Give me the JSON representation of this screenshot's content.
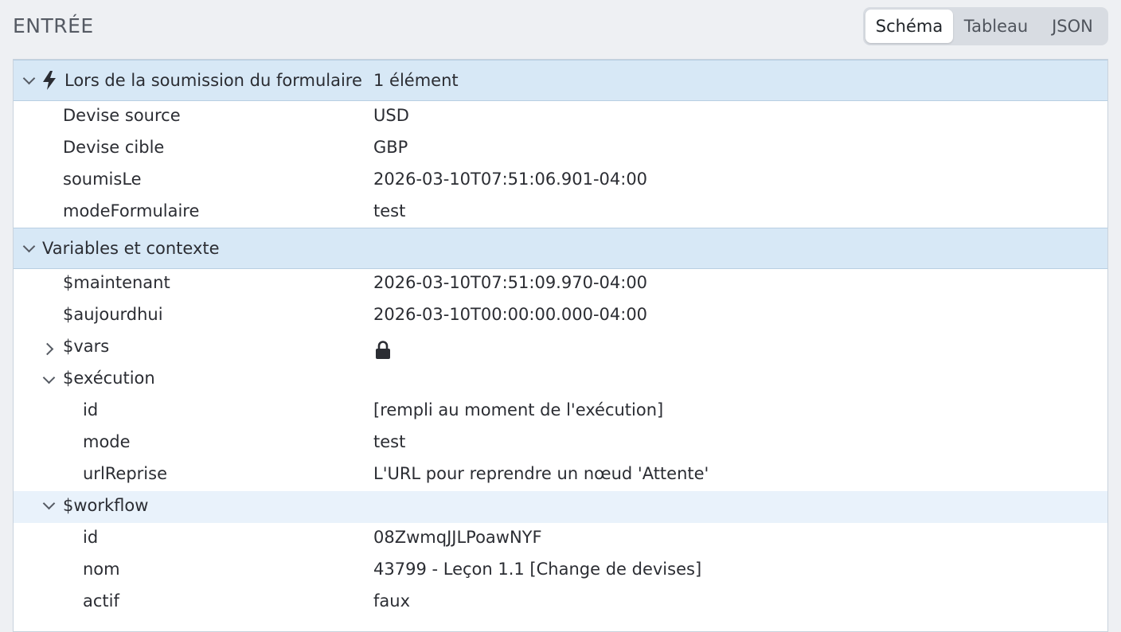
{
  "panel": {
    "title": "ENTRÉE"
  },
  "view_switch": {
    "options": [
      "Schéma",
      "Tableau",
      "JSON"
    ],
    "selected": "Schéma"
  },
  "trigger_section": {
    "label": "Lors de la soumission du formulaire",
    "count": "1 élément",
    "icon": "bolt-icon",
    "fields": [
      {
        "key": "Devise source",
        "value": "USD"
      },
      {
        "key": "Devise cible",
        "value": "GBP"
      },
      {
        "key": "soumisLe",
        "value": "2026-03-10T07:51:06.901-04:00"
      },
      {
        "key": "modeFormulaire",
        "value": "test"
      }
    ]
  },
  "variables_section": {
    "label": "Variables et contexte",
    "maintenant": {
      "key": "$maintenant",
      "value": "2026-03-10T07:51:09.970-04:00"
    },
    "aujourdhui": {
      "key": "$aujourdhui",
      "value": "2026-03-10T00:00:00.000-04:00"
    },
    "vars": {
      "key": "$vars",
      "icon": "lock-icon"
    },
    "execution": {
      "key": "$exécution",
      "fields": [
        {
          "key": "id",
          "value": "[rempli au moment de l'exécution]"
        },
        {
          "key": "mode",
          "value": "test"
        },
        {
          "key": "urlReprise",
          "value": "L'URL pour reprendre un nœud 'Attente'"
        }
      ]
    },
    "workflow": {
      "key": "$workflow",
      "fields": [
        {
          "key": "id",
          "value": "08ZwmqJJLPoawNYF"
        },
        {
          "key": "nom",
          "value": "43799 - Leçon 1.1 [Change de devises]"
        },
        {
          "key": "actif",
          "value": "faux"
        }
      ]
    }
  }
}
